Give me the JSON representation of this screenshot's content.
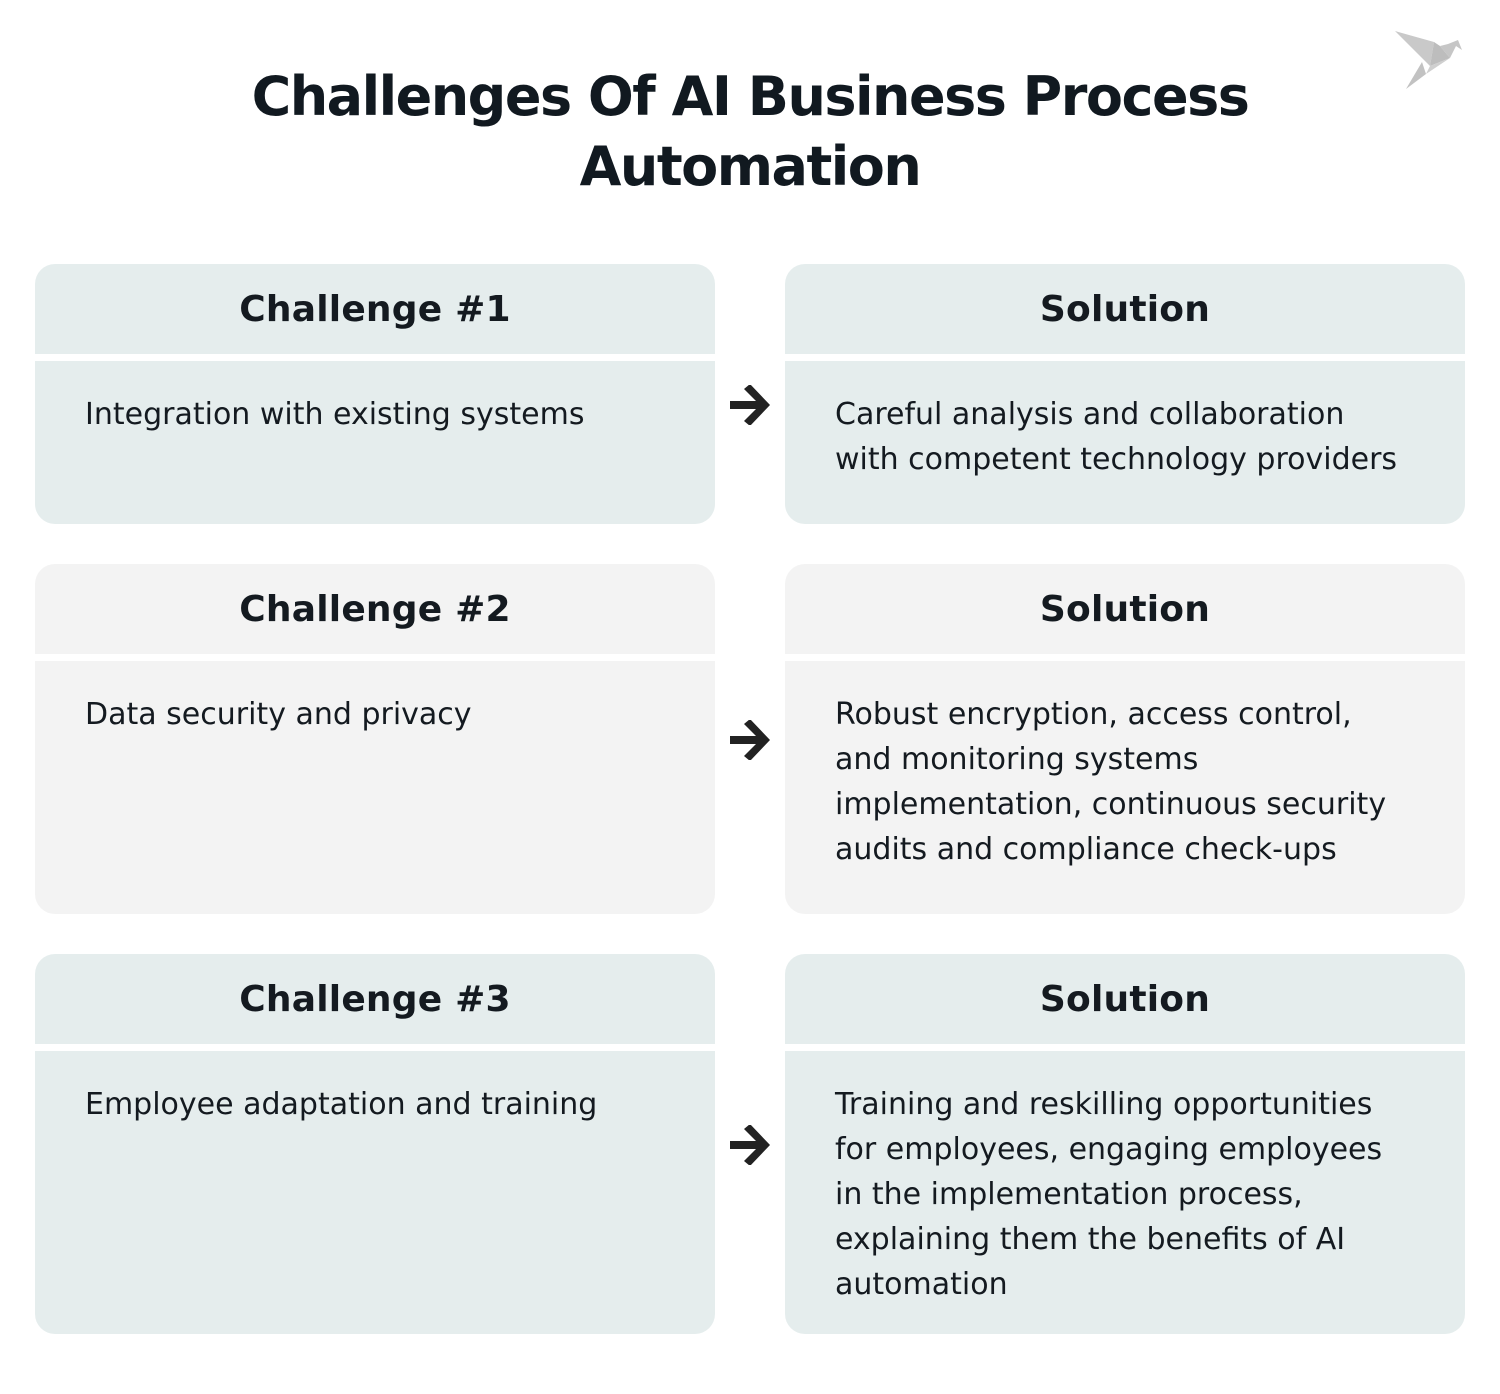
{
  "title": {
    "line1": "Challenges Of AI Business Process",
    "line2": "Automation"
  },
  "logo": {
    "icon": "origami-bird-icon"
  },
  "colors": {
    "row_teal": "#e5eded",
    "row_grey": "#f3f3f3",
    "text": "#141a20",
    "arrow": "#222222",
    "logo": "#c8c8c8"
  },
  "rows": [
    {
      "challenge_heading": "Challenge #1",
      "challenge_text": "Integration with existing systems",
      "solution_heading": "Solution",
      "solution_text": "Careful analysis and collaboration with competent technology providers"
    },
    {
      "challenge_heading": "Challenge #2",
      "challenge_text": "Data security and privacy",
      "solution_heading": "Solution",
      "solution_text": "Robust encryption, access control, and monitoring systems implementation, continuous security audits and compliance check-ups"
    },
    {
      "challenge_heading": "Challenge #3",
      "challenge_text": "Employee adaptation and training",
      "solution_heading": "Solution",
      "solution_text": "Training and reskilling opportunities for employees,  engaging employees in the implementation process, explaining them the benefits of AI automation"
    }
  ],
  "arrow_icon": "arrow-right-icon"
}
